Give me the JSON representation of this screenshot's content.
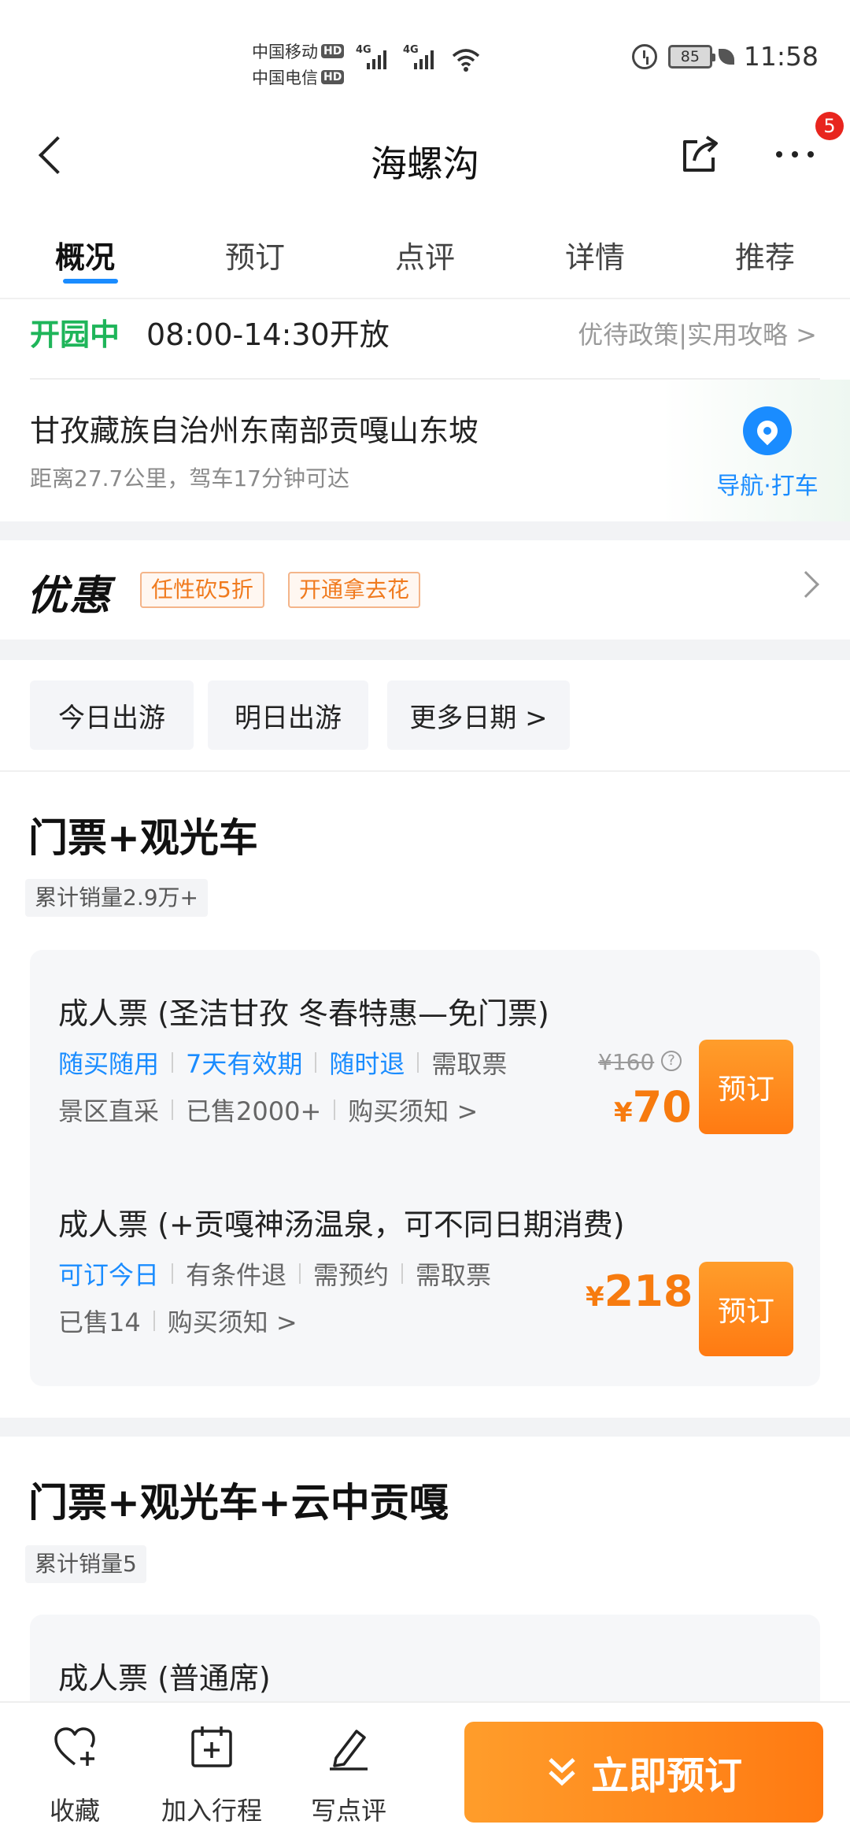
{
  "status_bar": {
    "carrier1": "中国移动",
    "carrier2": "中国电信",
    "hd": "HD",
    "net1": "4G",
    "net2": "4G",
    "battery": "85",
    "time": "11:58"
  },
  "header": {
    "title": "海螺沟",
    "badge_count": "5"
  },
  "tabs": [
    "概况",
    "预订",
    "点评",
    "详情",
    "推荐"
  ],
  "active_tab": "概况",
  "open_info": {
    "status": "开园中",
    "hours": "08:00-14:30开放",
    "policy_link": "优待政策|实用攻略 >"
  },
  "address": {
    "main": "甘孜藏族自治州东南部贡嘎山东坡",
    "distance": "距离27.7公里，驾车17分钟可达",
    "nav_label": "导航·打车"
  },
  "discount": {
    "title": "优惠",
    "tags": [
      "任性砍5折",
      "开通拿去花"
    ]
  },
  "dates": [
    "今日出游",
    "明日出游",
    "更多日期 >"
  ],
  "sections": [
    {
      "title": "门票+观光车",
      "sales": "累计销量2.9万+",
      "tickets": [
        {
          "name": "成人票 (圣洁甘孜 冬春特惠—免门票)",
          "features_line1": [
            "随买随用",
            "7天有效期",
            "随时退",
            "需取票"
          ],
          "features_line2": [
            "景区直采",
            "已售2000+",
            "购买须知 >"
          ],
          "original_price": "¥160",
          "currency": "¥",
          "price": "70",
          "button": "预订"
        },
        {
          "name": "成人票 (+贡嘎神汤温泉，可不同日期消费)",
          "features_line1": [
            "可订今日",
            "有条件退",
            "需预约",
            "需取票"
          ],
          "features_line2": [
            "已售14",
            "购买须知 >"
          ],
          "currency": "¥",
          "price": "218",
          "button": "预订"
        }
      ]
    },
    {
      "title": "门票+观光车+云中贡嘎",
      "sales": "累计销量5",
      "tickets": [
        {
          "name": "成人票 (普通席)"
        }
      ]
    }
  ],
  "bottom_bar": {
    "favorite": "收藏",
    "add_itinerary": "加入行程",
    "write_review": "写点评",
    "book_now": "立即预订"
  },
  "colors": {
    "accent_blue": "#1a8cff",
    "open_green": "#1fb55a",
    "price_orange": "#f77b0f",
    "badge_red": "#e8251e"
  }
}
